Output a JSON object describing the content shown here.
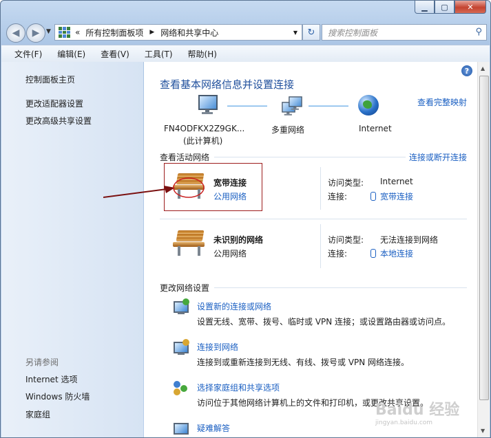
{
  "window": {
    "caption": {
      "minimize": "▁",
      "maximize": "▢",
      "close": "✕"
    }
  },
  "nav": {
    "back_glyph": "◀",
    "forward_glyph": "▶",
    "breadcrumb_prefix": "«",
    "crumbs": [
      "所有控制面板项",
      "网络和共享中心"
    ],
    "crumb_sep": "▶",
    "refresh_glyph": "↻",
    "search_placeholder": "搜索控制面板"
  },
  "menubar": [
    "文件(F)",
    "编辑(E)",
    "查看(V)",
    "工具(T)",
    "帮助(H)"
  ],
  "sidebar": {
    "links": [
      "控制面板主页",
      "更改适配器设置",
      "更改高级共享设置"
    ],
    "see_also_title": "另请参阅",
    "see_also": [
      "Internet 选项",
      "Windows 防火墙",
      "家庭组"
    ]
  },
  "main": {
    "help_glyph": "?",
    "title": "查看基本网络信息并设置连接",
    "view_full_map": "查看完整映射",
    "map": {
      "computer_name": "FN4ODFKX2Z9GK...",
      "computer_sub": "(此计算机)",
      "middle": "多重网络",
      "internet": "Internet"
    },
    "active_section": "查看活动网络",
    "connect_disconnect": "连接或断开连接",
    "networks": [
      {
        "name": "宽带连接",
        "category": "公用网络",
        "category_is_link": true,
        "access_label": "访问类型:",
        "access_value": "Internet",
        "conn_label": "连接:",
        "conn_value": "宽带连接"
      },
      {
        "name": "未识别的网络",
        "category": "公用网络",
        "category_is_link": false,
        "access_label": "访问类型:",
        "access_value": "无法连接到网络",
        "conn_label": "连接:",
        "conn_value": "本地连接"
      }
    ],
    "change_section": "更改网络设置",
    "tasks": [
      {
        "title": "设置新的连接或网络",
        "desc": "设置无线、宽带、拨号、临时或 VPN 连接；或设置路由器或访问点。"
      },
      {
        "title": "连接到网络",
        "desc": "连接到或重新连接到无线、有线、拨号或 VPN 网络连接。"
      },
      {
        "title": "选择家庭组和共享选项",
        "desc": "访问位于其他网络计算机上的文件和打印机，或更改共享设置。"
      },
      {
        "title": "疑难解答",
        "desc": ""
      }
    ]
  },
  "watermark": {
    "text": "Baidu 经验",
    "sub": "jingyan.baidu.com"
  },
  "colors": {
    "link": "#1a5fc2",
    "title": "#1f4f9c",
    "highlight_box": "#9c1b1b"
  }
}
